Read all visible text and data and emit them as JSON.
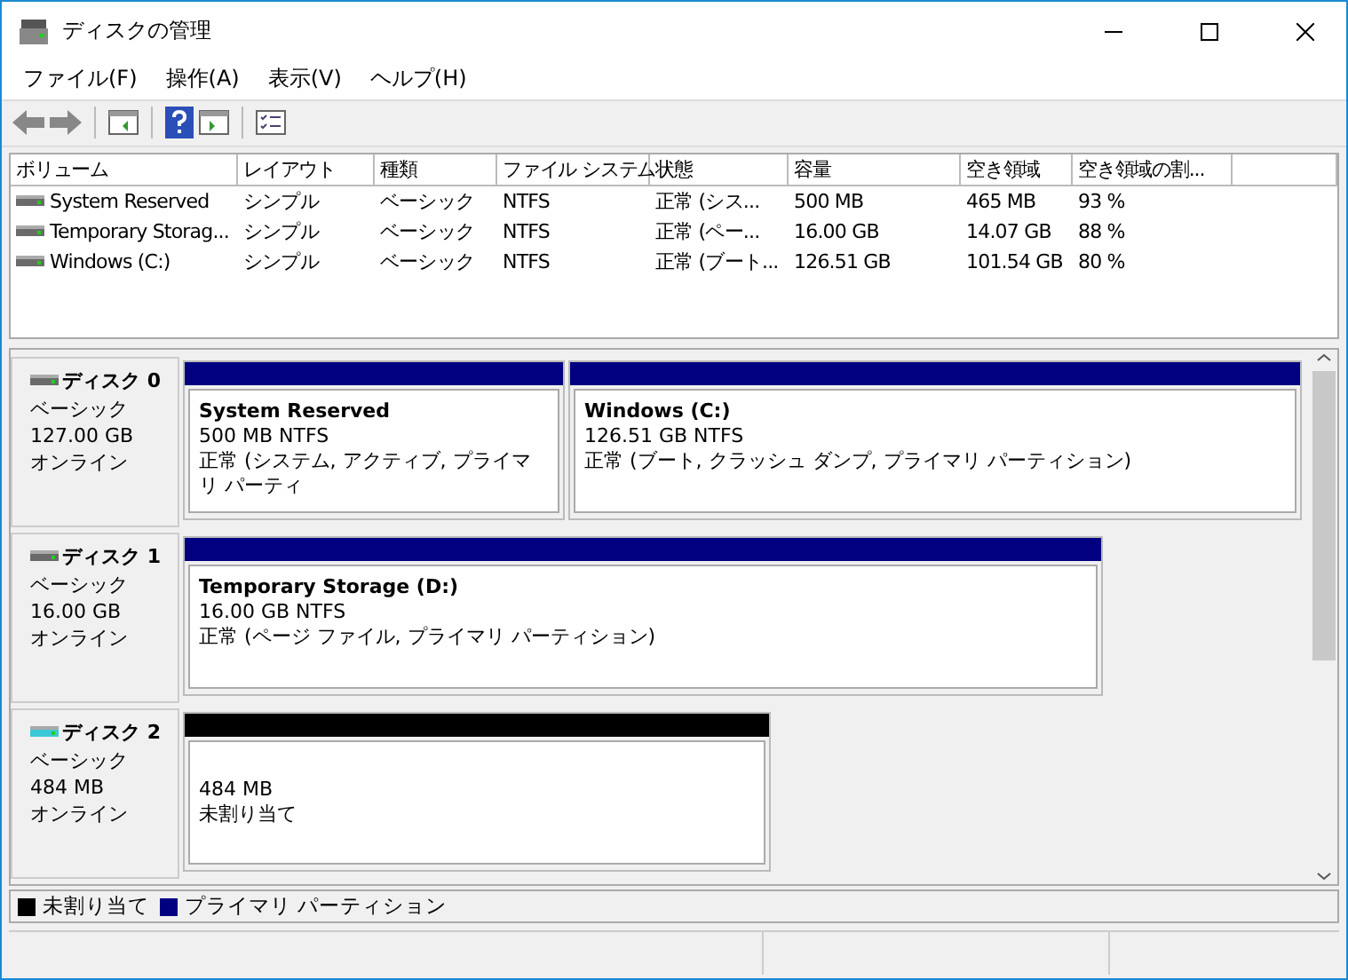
{
  "window": {
    "title": "ディスクの管理"
  },
  "menu": [
    "ファイル(F)",
    "操作(A)",
    "表示(V)",
    "ヘルプ(H)"
  ],
  "volume_table": {
    "columns": [
      "ボリューム",
      "レイアウト",
      "種類",
      "ファイル システム",
      "状態",
      "容量",
      "空き領域",
      "空き領域の割..."
    ],
    "rows": [
      {
        "cells": [
          "System Reserved",
          "シンプル",
          "ベーシック",
          "NTFS",
          "正常 (シス...",
          "500 MB",
          "465 MB",
          "93 %"
        ]
      },
      {
        "cells": [
          "Temporary Storag...",
          "シンプル",
          "ベーシック",
          "NTFS",
          "正常 (ペー...",
          "16.00 GB",
          "14.07 GB",
          "88 %"
        ]
      },
      {
        "cells": [
          "Windows (C:)",
          "シンプル",
          "ベーシック",
          "NTFS",
          "正常 (ブート...",
          "126.51 GB",
          "101.54 GB",
          "80 %"
        ]
      }
    ]
  },
  "disks": [
    {
      "name": "ディスク 0",
      "kind": "standard",
      "type": "ベーシック",
      "size": "127.00 GB",
      "status": "オンライン",
      "partitions": [
        {
          "kind": "primary",
          "title": "System Reserved",
          "size": "500 MB NTFS",
          "status": "正常 (システム, アクティブ, プライマリ パーティ"
        },
        {
          "kind": "primary",
          "title": "Windows  (C:)",
          "size": "126.51 GB NTFS",
          "status": "正常 (ブート, クラッシュ ダンプ, プライマリ パーティション)"
        }
      ]
    },
    {
      "name": "ディスク 1",
      "kind": "standard",
      "type": "ベーシック",
      "size": "16.00 GB",
      "status": "オンライン",
      "partitions": [
        {
          "kind": "primary",
          "title": "Temporary Storage  (D:)",
          "size": "16.00 GB NTFS",
          "status": "正常 (ページ ファイル, プライマリ パーティション)"
        }
      ]
    },
    {
      "name": "ディスク 2",
      "kind": "accent",
      "type": "ベーシック",
      "size": "484 MB",
      "status": "オンライン",
      "partitions": [
        {
          "kind": "unallocated",
          "size": "484 MB",
          "status": "未割り当て"
        }
      ]
    }
  ],
  "legend": [
    {
      "label": "未割り当て",
      "color": "#000000"
    },
    {
      "label": "プライマリ パーティション",
      "color": "#000080"
    }
  ]
}
